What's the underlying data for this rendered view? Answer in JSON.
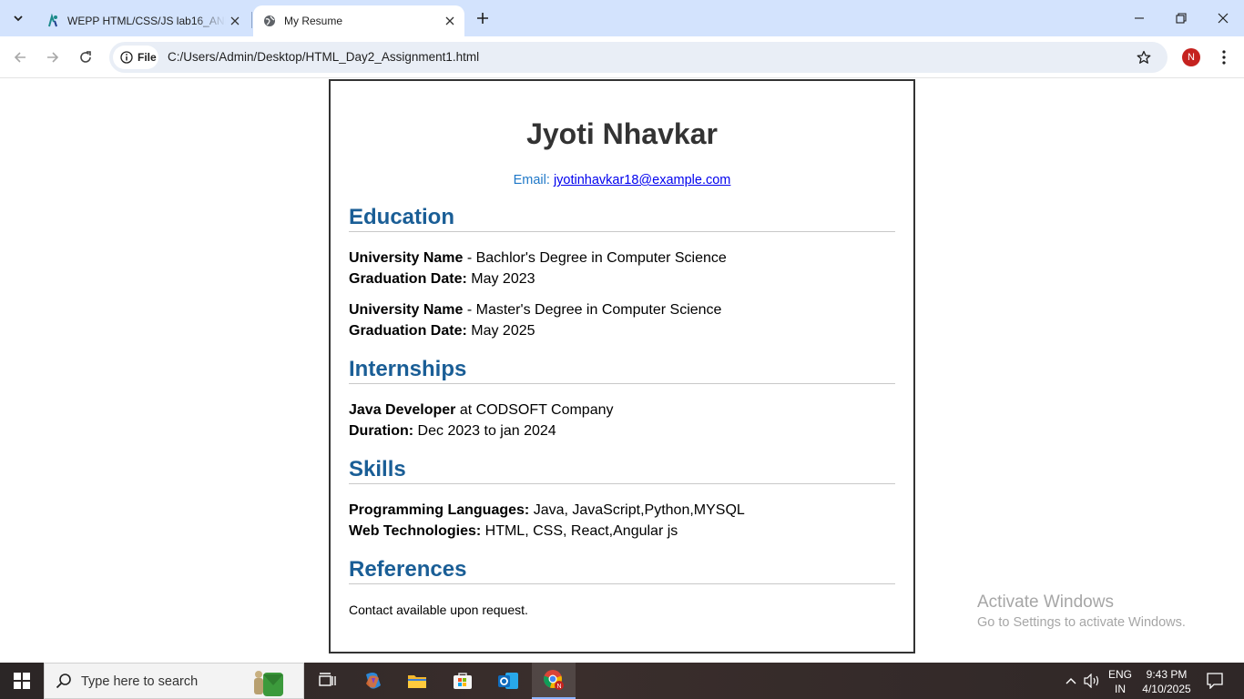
{
  "browser": {
    "tabs": [
      {
        "title": "WEPP HTML/CSS/JS lab16_ANP",
        "active": false
      },
      {
        "title": "My Resume",
        "active": true
      }
    ],
    "address": {
      "chip_label": "File",
      "url": "C:/Users/Admin/Desktop/HTML_Day2_Assignment1.html"
    },
    "profile_initial": "N"
  },
  "resume": {
    "name": "Jyoti Nhavkar",
    "email_label": "Email:",
    "email": "jyotinhavkar18@example.com",
    "education": {
      "heading": "Education",
      "entries": [
        {
          "school": "University Name",
          "degree": " - Bachlor's Degree in Computer Science",
          "grad_label": "Graduation Date:",
          "grad_date": " May 2023"
        },
        {
          "school": "University Name",
          "degree": " - Master's Degree in Computer Science",
          "grad_label": "Graduation Date:",
          "grad_date": " May 2025"
        }
      ]
    },
    "internships": {
      "heading": "Internships",
      "role": "Java Developer",
      "company": " at CODSOFT Company",
      "duration_label": "Duration:",
      "duration": " Dec 2023 to jan 2024"
    },
    "skills": {
      "heading": "Skills",
      "prog_label": "Programming Languages:",
      "prog_value": " Java, JavaScript,Python,MYSQL",
      "web_label": "Web Technologies:",
      "web_value": " HTML, CSS, React,Angular js"
    },
    "references": {
      "heading": "References",
      "text": "Contact available upon request."
    }
  },
  "watermark": {
    "line1": "Activate Windows",
    "line2": "Go to Settings to activate Windows."
  },
  "taskbar": {
    "search_placeholder": "Type here to search",
    "language": "ENG",
    "region": "IN",
    "time": "9:43 PM",
    "date": "4/10/2025"
  },
  "colors": {
    "accent_heading": "#1a5e96",
    "email_label": "#1f78c8",
    "link": "#0000ee",
    "tabstrip": "#d3e3fd"
  }
}
